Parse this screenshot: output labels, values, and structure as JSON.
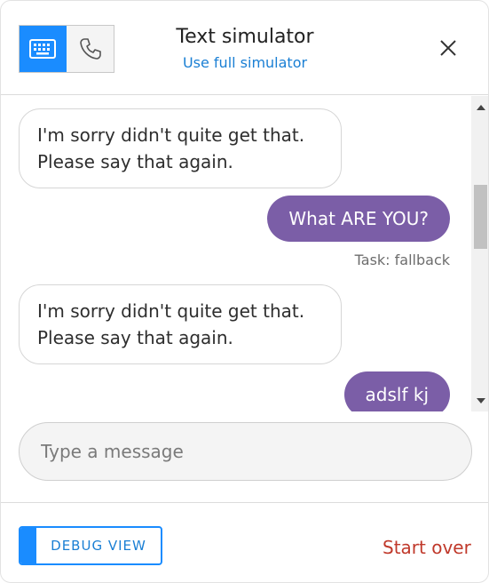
{
  "header": {
    "title": "Text simulator",
    "subtitle_link": "Use full simulator",
    "modes": [
      {
        "name": "keyboard",
        "icon": "keyboard-icon",
        "active": true
      },
      {
        "name": "phone",
        "icon": "phone-icon",
        "active": false
      }
    ],
    "close_icon": "close-icon"
  },
  "transcript": [
    {
      "sender": "bot",
      "text_line1": "I'm sorry didn't quite get that.",
      "text_line2": "Please say that again."
    },
    {
      "sender": "user",
      "text": "What ARE YOU?",
      "task": "Task: fallback"
    },
    {
      "sender": "bot",
      "text_line1": "I'm sorry didn't quite get that.",
      "text_line2": "Please say that again."
    },
    {
      "sender": "user",
      "text": "adslf kj"
    }
  ],
  "input": {
    "placeholder": "Type a message",
    "value": ""
  },
  "footer": {
    "debug_label": "DEBUG VIEW",
    "start_over_label": "Start over"
  },
  "colors": {
    "accent": "#1a8cff",
    "user_bubble": "#7b5ea7",
    "start_over": "#c0392b",
    "link": "#1a7fd4"
  }
}
